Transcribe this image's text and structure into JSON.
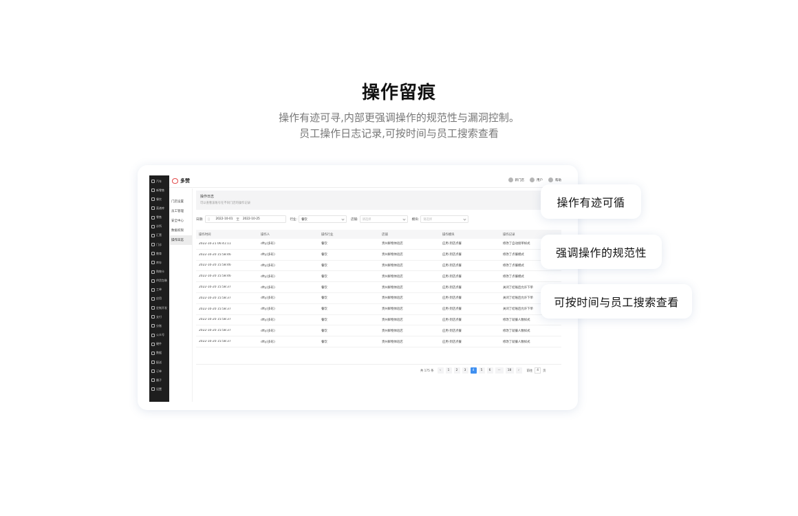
{
  "hero": {
    "title": "操作留痕",
    "subtitle_line1": "操作有迹可寻,内部更强调操作的规范性与漏洞控制。",
    "subtitle_line2": "员工操作日志记录,可按时间与员工搜索查看"
  },
  "app": {
    "brand": "多赞",
    "sidebar": [
      {
        "label": "汽车"
      },
      {
        "label": "新零售"
      },
      {
        "label": "餐饮"
      },
      {
        "label": "菜谱库"
      },
      {
        "label": "零售"
      },
      {
        "label": "诊所"
      },
      {
        "label": "汇营"
      },
      {
        "label": "门诊"
      },
      {
        "label": "教育"
      },
      {
        "label": "库存"
      },
      {
        "label": "购物卡"
      },
      {
        "label": "供货包装"
      },
      {
        "label": "工单"
      },
      {
        "label": "应用"
      },
      {
        "label": "定制开发"
      },
      {
        "label": "支付"
      },
      {
        "label": "分账"
      },
      {
        "label": "公众号"
      },
      {
        "label": "硬件"
      },
      {
        "label": "数据"
      },
      {
        "label": "配送"
      },
      {
        "label": "订单"
      },
      {
        "label": "圈子"
      },
      {
        "label": "设置"
      }
    ],
    "topbar": {
      "store": "新门店",
      "user": "用户",
      "help": "帮助"
    },
    "sub_nav": [
      {
        "label": "门店设置"
      },
      {
        "label": "员工管理"
      },
      {
        "label": "安全中心"
      },
      {
        "label": "数据权限"
      },
      {
        "label": "操作日志"
      }
    ],
    "active_sub_nav": "操作日志",
    "notice": {
      "title": "操作日志",
      "desc": "可以查看该账号在不同门店的操作记录"
    },
    "filters": {
      "date_label": "日期:",
      "calendar_prefix": "日",
      "date_from": "2022-10-01",
      "date_sep": "至",
      "date_to": "2022-10-25",
      "industry_label": "行业:",
      "industry_value": "餐饮",
      "store_label": "店铺:",
      "store_placeholder": "请选择",
      "module_label": "模块:",
      "module_placeholder": "请选择"
    },
    "table": {
      "columns": [
        "操作时间",
        "操作人",
        "操作行业",
        "店铺",
        "操作模块",
        "操作记录"
      ],
      "rows": [
        [
          "2022-10-21 06:41:11",
          "dfty(多彩)",
          "餐饮",
          "贵州鲜物体验店",
          "应用-到店点餐",
          "修改了自动接单样式"
        ],
        [
          "2022-10-20 15:58:46",
          "dfty(多彩)",
          "餐饮",
          "贵州鲜物体验店",
          "应用-到店点餐",
          "修改了点餐模式"
        ],
        [
          "2022-10-20 15:58:46",
          "dfty(多彩)",
          "餐饮",
          "贵州鲜物体验店",
          "应用-到店点餐",
          "修改了点餐模式"
        ],
        [
          "2022-10-20 15:58:46",
          "dfty(多彩)",
          "餐饮",
          "贵州鲜物体验店",
          "应用-到店点餐",
          "修改了点餐模式"
        ],
        [
          "2022-10-20 15:58:37",
          "dfty(多彩)",
          "餐饮",
          "贵州鲜物体验店",
          "应用-到店点餐",
          "关闭了结账后允许下单"
        ],
        [
          "2022-10-20 15:58:37",
          "dfty(多彩)",
          "餐饮",
          "贵州鲜物体验店",
          "应用-到店点餐",
          "关闭了结账后允许下单"
        ],
        [
          "2022-10-20 15:58:37",
          "dfty(多彩)",
          "餐饮",
          "贵州鲜物体验店",
          "应用-到店点餐",
          "关闭了结账后允许下单"
        ],
        [
          "2022-10-20 15:58:37",
          "dfty(多彩)",
          "餐饮",
          "贵州鲜物体验店",
          "应用-到店点餐",
          "修改了就餐人数样式"
        ],
        [
          "2022-10-20 15:58:37",
          "dfty(多彩)",
          "餐饮",
          "贵州鲜物体验店",
          "应用-到店点餐",
          "修改了就餐人数样式"
        ],
        [
          "2022-10-20 15:58:37",
          "dfty(多彩)",
          "餐饮",
          "贵州鲜物体验店",
          "应用-到店点餐",
          "修改了就餐人数样式"
        ]
      ]
    },
    "pagination": {
      "total": "共 175 条",
      "prev": "‹",
      "pages": [
        "1",
        "2",
        "3",
        "4",
        "5",
        "6",
        "···",
        "18"
      ],
      "active_page": "4",
      "next": "›",
      "goto_label": "前往",
      "goto_value": "4",
      "goto_suffix": "页"
    }
  },
  "callouts": [
    "操作有迹可循",
    "强调操作的规范性",
    "可按时间与员工搜索查看"
  ],
  "colors": {
    "accent": "#3f8ff0",
    "sidebar": "#1e1e1e",
    "logo": "#e24646"
  }
}
